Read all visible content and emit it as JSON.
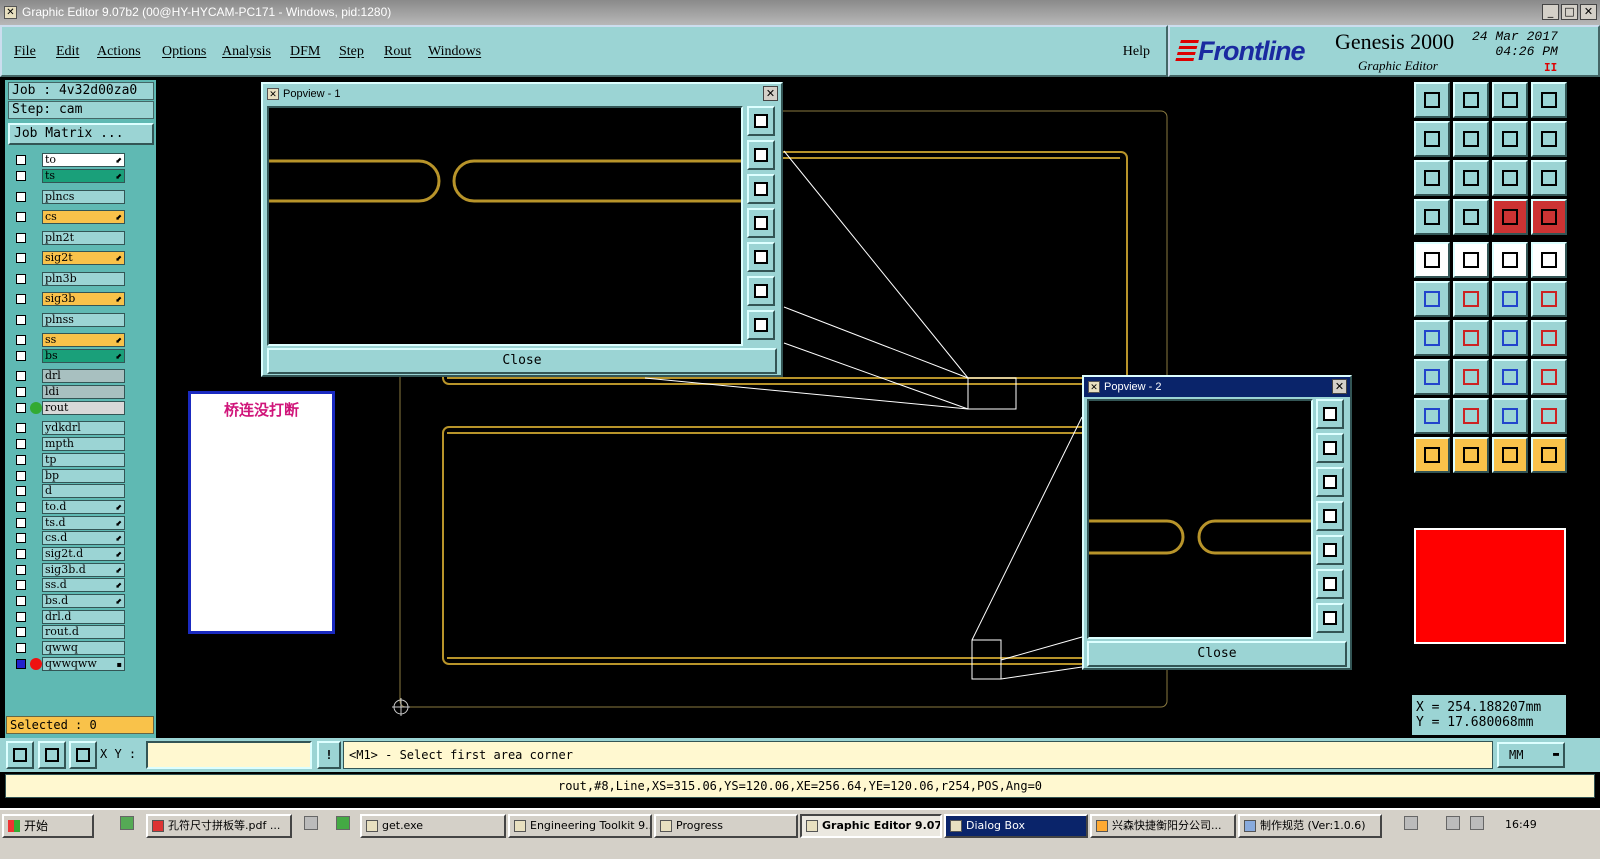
{
  "window": {
    "title": "Graphic Editor 9.07b2 (00@HY-HYCAM-PC171 - Windows, pid:1280)",
    "min": "_",
    "max": "□",
    "close": "✕"
  },
  "menu": [
    "File",
    "Edit",
    "Actions",
    "Options",
    "Analysis",
    "DFM",
    "Step",
    "Rout",
    "Windows"
  ],
  "help": "Help",
  "brand": {
    "logo": "Frontline",
    "product": "Genesis 2000",
    "subtitle": "Graphic Editor",
    "date": "24 Mar 2017",
    "time": "04:26 PM",
    "indicator": "II"
  },
  "job": "Job : 4v32d00za0",
  "step": "Step: cam",
  "job_matrix": "Job Matrix ...",
  "layers": [
    {
      "name": "to",
      "color": "#ffffff",
      "mark": "⬋"
    },
    {
      "name": "ts",
      "color": "#1aa07a",
      "mark": "⬋"
    },
    {
      "name": "plncs",
      "color": "#9bd4d4",
      "mark": ""
    },
    {
      "name": "cs",
      "color": "#f9c24a",
      "mark": "⬋"
    },
    {
      "name": "pln2t",
      "color": "#9bd4d4",
      "mark": ""
    },
    {
      "name": "sig2t",
      "color": "#f9c24a",
      "mark": "⬋"
    },
    {
      "name": "pln3b",
      "color": "#9bd4d4",
      "mark": ""
    },
    {
      "name": "sig3b",
      "color": "#f9c24a",
      "mark": "⬋"
    },
    {
      "name": "plnss",
      "color": "#9bd4d4",
      "mark": ""
    },
    {
      "name": "ss",
      "color": "#f9c24a",
      "mark": "⬋"
    },
    {
      "name": "bs",
      "color": "#1aa07a",
      "mark": "⬋"
    },
    {
      "name": "drl",
      "color": "#a8c0c0",
      "mark": ""
    },
    {
      "name": "ldi",
      "color": "#a8c0c0",
      "mark": ""
    },
    {
      "name": "rout",
      "color": "#d8d8d8",
      "mark": ""
    },
    {
      "name": "ydkdrl",
      "color": "#9bd4d4",
      "mark": ""
    },
    {
      "name": "mpth",
      "color": "#9bd4d4",
      "mark": ""
    },
    {
      "name": "tp",
      "color": "#9bd4d4",
      "mark": ""
    },
    {
      "name": "bp",
      "color": "#9bd4d4",
      "mark": ""
    },
    {
      "name": "d",
      "color": "#9bd4d4",
      "mark": ""
    },
    {
      "name": "to.d",
      "color": "#9bd4d4",
      "mark": "⬋"
    },
    {
      "name": "ts.d",
      "color": "#9bd4d4",
      "mark": "⬋"
    },
    {
      "name": "cs.d",
      "color": "#9bd4d4",
      "mark": "⬋"
    },
    {
      "name": "sig2t.d",
      "color": "#9bd4d4",
      "mark": "⬋"
    },
    {
      "name": "sig3b.d",
      "color": "#9bd4d4",
      "mark": "⬋"
    },
    {
      "name": "ss.d",
      "color": "#9bd4d4",
      "mark": "⬋"
    },
    {
      "name": "bs.d",
      "color": "#9bd4d4",
      "mark": "⬋"
    },
    {
      "name": "drl.d",
      "color": "#9bd4d4",
      "mark": ""
    },
    {
      "name": "rout.d",
      "color": "#9bd4d4",
      "mark": ""
    },
    {
      "name": "qwwq",
      "color": "#9bd4d4",
      "mark": ""
    },
    {
      "name": "qwwqww",
      "color": "#9bd4d4",
      "mark": "▪"
    }
  ],
  "selected": "Selected : 0",
  "note": "桥连没打断",
  "popview1": {
    "title": "Popview - 1",
    "close": "Close"
  },
  "popview2": {
    "title": "Popview - 2",
    "close": "Close"
  },
  "coords": {
    "x": "X = 254.188207mm",
    "y": "Y = 17.680068mm"
  },
  "xy_label": "X Y :",
  "xy_value": "",
  "warn": "!",
  "prompt": "<M1> - Select first area corner",
  "units": "MM",
  "units_arrow": "▬",
  "status": "rout,#8,Line,XS=315.06,YS=120.06,XE=256.64,YE=120.06,r254,POS,Ang=0",
  "taskbar": {
    "start": "开始",
    "tasks": [
      "孔符尺寸拼板等.pdf ...",
      "get.exe",
      "Engineering Toolkit 9....",
      "Progress",
      "Graphic Editor 9.07...",
      "Dialog Box",
      "兴森快捷衡阳分公司...",
      "制作规范 (Ver:1.0.6)"
    ],
    "clock": "16:49"
  },
  "colors": {
    "panel": "#9bd4d4",
    "rout_line": "#b8942a",
    "outline": "#8a7a40",
    "accent_red": "#ff0000"
  }
}
